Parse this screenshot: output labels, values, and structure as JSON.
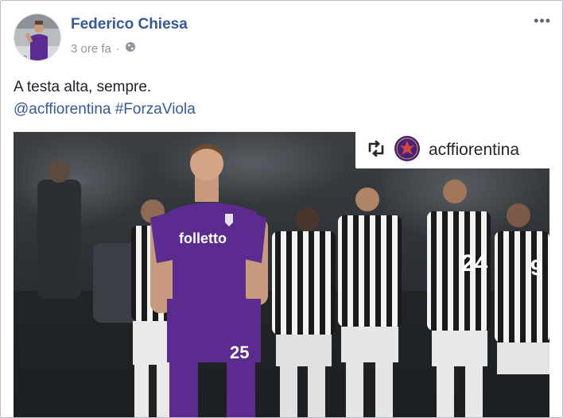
{
  "post": {
    "author": "Federico Chiesa",
    "time": "3 ore fa",
    "separator": "·",
    "text_line1": "A testa alta, sempre.",
    "mention": "@acffiorentina",
    "hashtag": "#ForzaViola"
  },
  "photo": {
    "repost_handle": "acffiorentina",
    "shirt_sponsor": "folletto",
    "shirt_number": "25",
    "opponent_number_1": "24",
    "opponent_number_2": "9"
  },
  "icons": {
    "more": "more-options-icon",
    "privacy": "globe-icon",
    "repost": "repost-icon"
  },
  "colors": {
    "link": "#365899",
    "meta": "#90949c",
    "viola": "#5b2b8f"
  }
}
